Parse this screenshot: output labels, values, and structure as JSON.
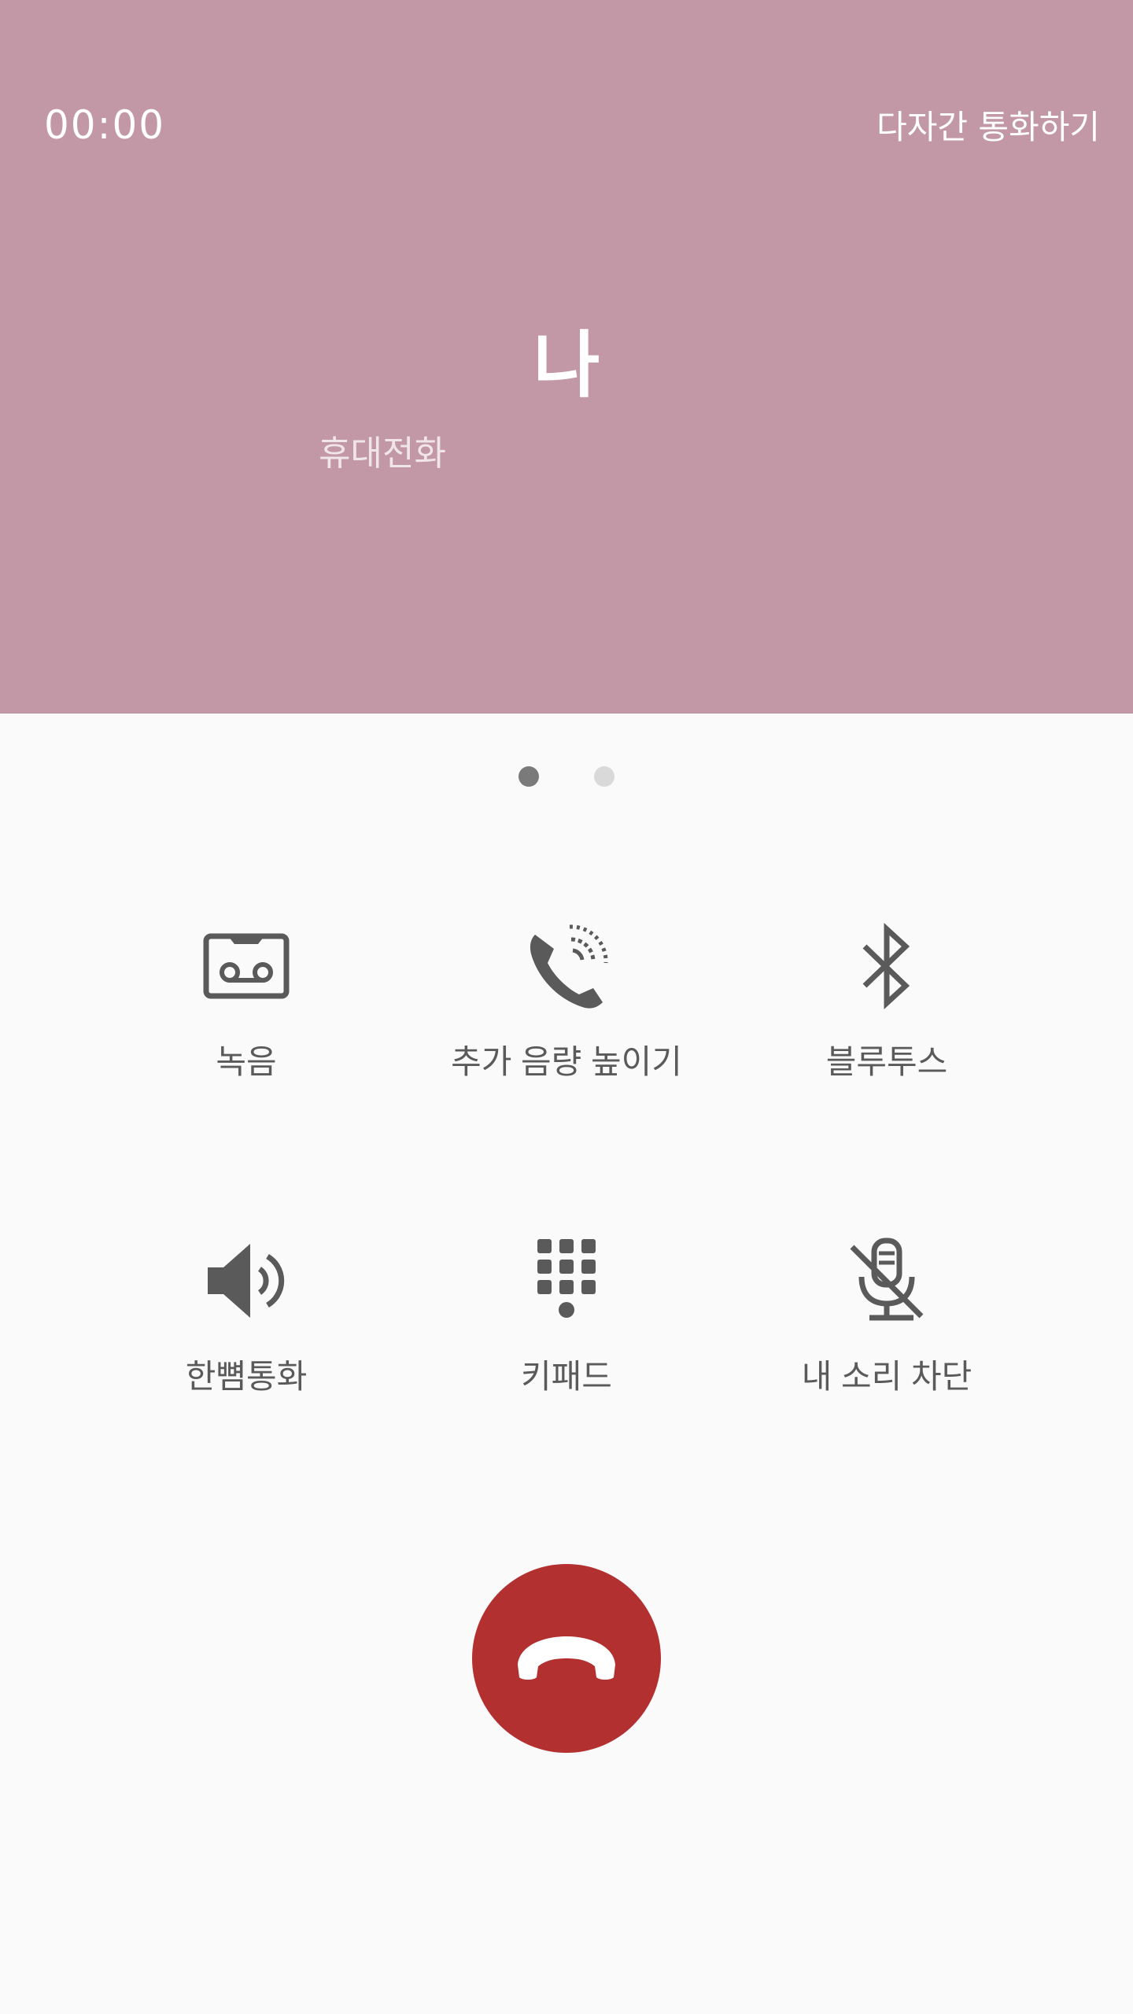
{
  "call": {
    "timer": "00:00",
    "conference_label": "다자간 통화하기",
    "caller_name": "나",
    "caller_type": "휴대전화"
  },
  "pager": {
    "pages": 2,
    "active": 1
  },
  "controls": [
    {
      "label": "녹음",
      "icon": "cassette-record-icon"
    },
    {
      "label": "추가 음량 높이기",
      "icon": "phone-volume-boost-icon"
    },
    {
      "label": "블루투스",
      "icon": "bluetooth-icon"
    },
    {
      "label": "한뼘통화",
      "icon": "speaker-icon"
    },
    {
      "label": "키패드",
      "icon": "keypad-icon"
    },
    {
      "label": "내 소리 차단",
      "icon": "mic-mute-icon"
    }
  ],
  "end_call": {
    "icon": "end-call-icon"
  },
  "colors": {
    "header_bg": "#c297a6",
    "body_bg": "#fafafa",
    "icon": "#5a5a5a",
    "end_call": "#b33031"
  }
}
